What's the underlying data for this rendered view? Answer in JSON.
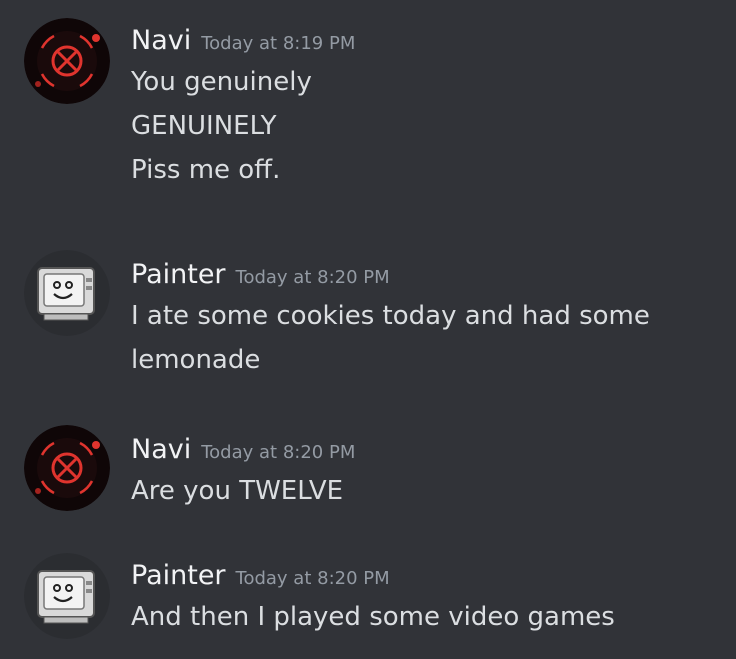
{
  "colors": {
    "background": "#313338",
    "author": "#f2f3f5",
    "timestamp": "#949ba4",
    "message_text": "#dbdee1",
    "navi_accent": "#e0342e"
  },
  "messages": [
    {
      "author": "Navi",
      "timestamp": "Today at 8:19 PM",
      "avatar_icon": "red-crosshair-avatar",
      "lines": [
        "You genuinely",
        "GENUINELY",
        "Piss me off."
      ]
    },
    {
      "author": "Painter",
      "timestamp": "Today at 8:20 PM",
      "avatar_icon": "retro-computer-face-avatar",
      "lines": [
        "I ate some cookies today and had some",
        "lemonade"
      ]
    },
    {
      "author": "Navi",
      "timestamp": "Today at 8:20 PM",
      "avatar_icon": "red-crosshair-avatar",
      "lines": [
        "Are you TWELVE"
      ]
    },
    {
      "author": "Painter",
      "timestamp": "Today at 8:20 PM",
      "avatar_icon": "retro-computer-face-avatar",
      "lines": [
        "And then I played some video games"
      ]
    }
  ]
}
